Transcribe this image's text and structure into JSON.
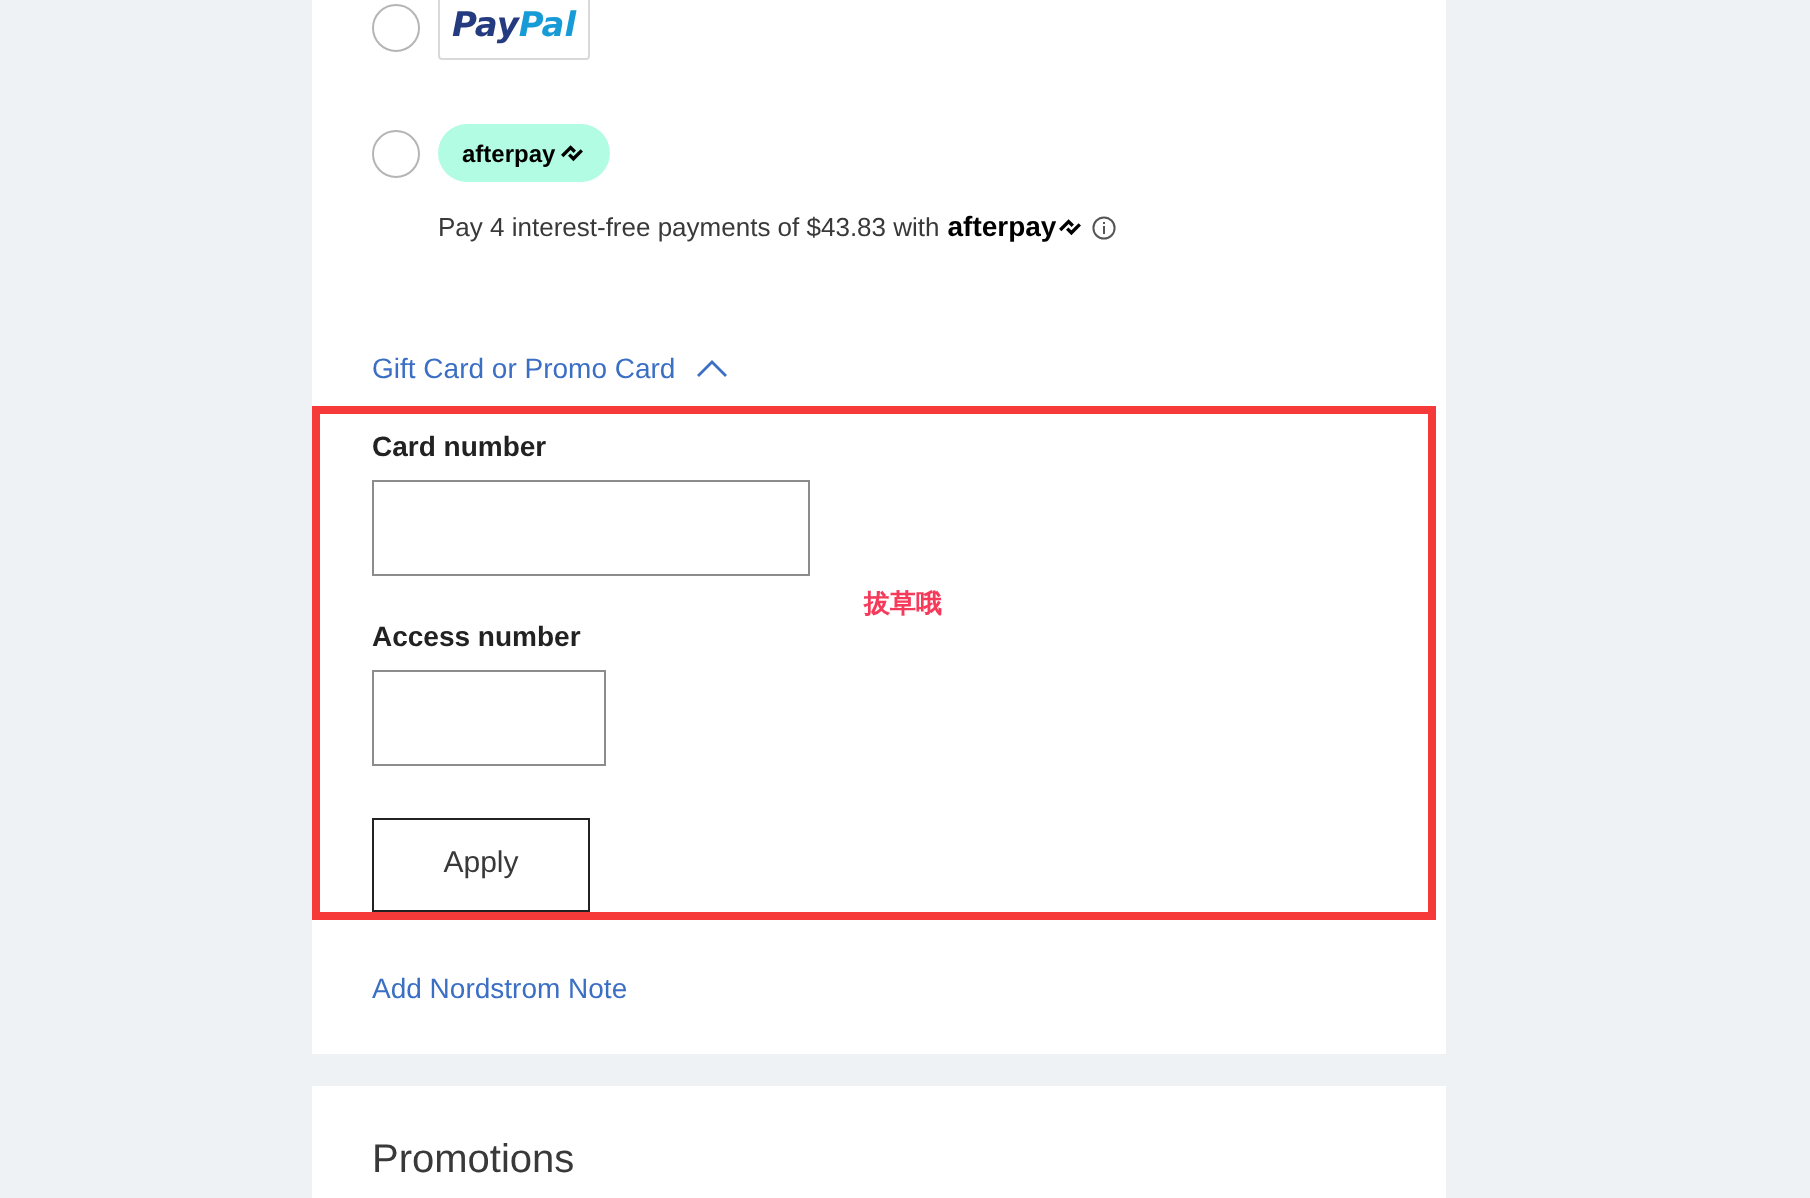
{
  "payment_methods": [
    {
      "kind": "paypal",
      "selected": false,
      "logo_parts": [
        "Pay",
        "Pal"
      ]
    },
    {
      "kind": "afterpay",
      "selected": false,
      "logo": "afterpay",
      "description": "Pay 4 interest-free payments of $43.83 with",
      "description_logo": "afterpay"
    }
  ],
  "gift_card": {
    "label": "Gift Card or Promo Card",
    "expanded": true,
    "fields": [
      {
        "label": "Card number",
        "kind": "wide"
      },
      {
        "label": "Access number",
        "kind": "narrow"
      }
    ],
    "button": "Apply"
  },
  "annotation": {
    "text": "拔草哦"
  },
  "note_link": "Add Nordstrom Note",
  "promotions": {
    "title": "Promotions"
  }
}
